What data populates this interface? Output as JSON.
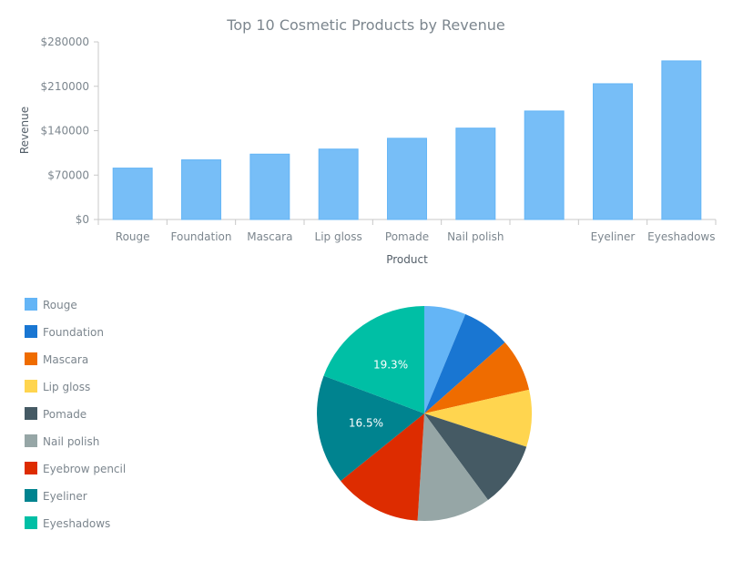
{
  "chart_data": [
    {
      "type": "bar",
      "title": "Top 10 Cosmetic Products by Revenue",
      "xlabel": "Product",
      "ylabel": "Revenue",
      "categories": [
        "Rouge",
        "Foundation",
        "Mascara",
        "Lip gloss",
        "Pomade",
        "Nail polish",
        "Eyebrow pencil",
        "Eyeliner",
        "Eyeshadows"
      ],
      "visible_category_labels": [
        "Rouge",
        "Foundation",
        "Mascara",
        "Lip gloss",
        "Pomade",
        "Nail polish",
        "",
        "Eyeliner",
        "Eyeshadows"
      ],
      "values": [
        81000,
        94000,
        103000,
        111000,
        128000,
        144000,
        171000,
        214000,
        250000
      ],
      "ylim": [
        0,
        280000
      ],
      "yticks": [
        0,
        70000,
        140000,
        210000,
        280000
      ],
      "ytick_labels": [
        "$0",
        "$70000",
        "$140000",
        "$210000",
        "$280000"
      ],
      "grid": false,
      "bar_color": "#64b5f6"
    },
    {
      "type": "pie",
      "categories": [
        "Rouge",
        "Foundation",
        "Mascara",
        "Lip gloss",
        "Pomade",
        "Nail polish",
        "Eyebrow pencil",
        "Eyeliner",
        "Eyeshadows"
      ],
      "values": [
        81000,
        94000,
        103000,
        111000,
        128000,
        144000,
        171000,
        214000,
        250000
      ],
      "colors": [
        "#64b5f6",
        "#1976d2",
        "#ef6c00",
        "#ffd54f",
        "#455a64",
        "#96a6a6",
        "#dd2c00",
        "#00838f",
        "#00bfa5"
      ],
      "data_labels": [
        {
          "category": "Eyeliner",
          "text": "16.5%"
        },
        {
          "category": "Eyeshadows",
          "text": "19.3%"
        }
      ],
      "legend": "left"
    }
  ]
}
